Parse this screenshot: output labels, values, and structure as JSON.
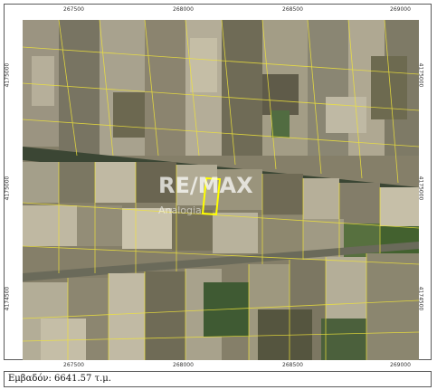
{
  "map": {
    "x_ticks_top": [
      "267500",
      "268000",
      "268500",
      "269000"
    ],
    "x_ticks_bottom": [
      "267500",
      "268000",
      "268500",
      "269000"
    ],
    "y_ticks_left": [
      "4175000",
      "4175000",
      "4174500"
    ],
    "y_ticks_right": [
      "4175000",
      "4175000",
      "4174500"
    ],
    "parcel_outline_color": "#f0e43a",
    "highlight_color": "#ffff00"
  },
  "watermark": {
    "brand": "RE/MAX",
    "office": "Analogia"
  },
  "caption": {
    "text": "Εμβαδόν: 6641.57 τ.μ."
  }
}
